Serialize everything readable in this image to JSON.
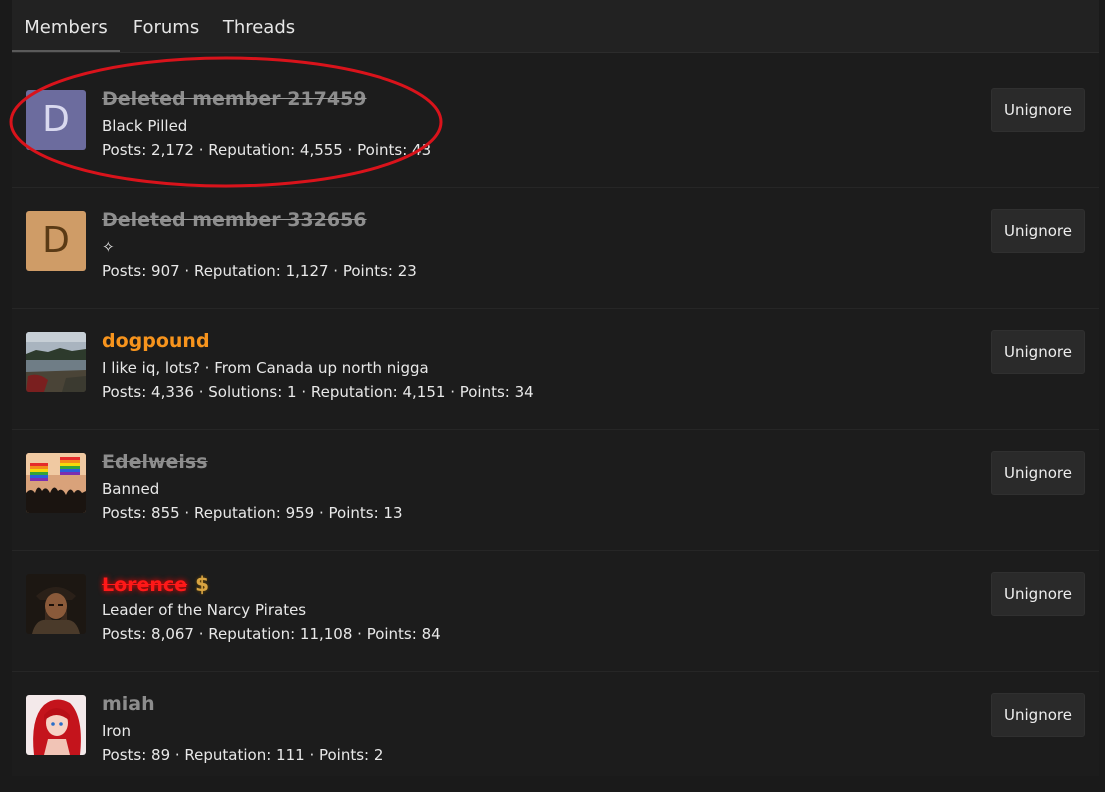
{
  "tabs": [
    {
      "label": "Members",
      "active": true
    },
    {
      "label": "Forums",
      "active": false
    },
    {
      "label": "Threads",
      "active": false
    }
  ],
  "members": [
    {
      "name": "Deleted member 217459",
      "title": "Black Pilled",
      "stats": "Posts: 2,172 · Reputation: 4,555 · Points: 43",
      "avatar_letter": "D",
      "avatar_color": "#6c6c9e",
      "avatar_letter_color": "#d9d9ef",
      "button": "Unignore"
    },
    {
      "name": "Deleted member 332656",
      "title": "✧",
      "stats": "Posts: 907 · Reputation: 1,127 · Points: 23",
      "avatar_letter": "D",
      "avatar_color": "#cf9c67",
      "avatar_letter_color": "#5a3a15",
      "button": "Unignore"
    },
    {
      "name": "dogpound",
      "title": "I like iq, lots? · From Canada up north nigga",
      "stats": "Posts: 4,336 · Solutions: 1 · Reputation: 4,151 · Points: 34",
      "button": "Unignore"
    },
    {
      "name": "Edelweiss",
      "title": "Banned",
      "stats": "Posts: 855 · Reputation: 959 · Points: 13",
      "button": "Unignore"
    },
    {
      "name": "Lorence",
      "badge": "$",
      "title": "Leader of the Narcy Pirates",
      "stats": "Posts: 8,067 · Reputation: 11,108 · Points: 84",
      "button": "Unignore"
    },
    {
      "name": "miah",
      "title": "Iron",
      "stats": "Posts: 89 · Reputation: 111 · Points: 2",
      "button": "Unignore"
    }
  ],
  "colors": {
    "background": "#1c1c1c",
    "deleted_name": "#8d8d8d",
    "orange_name": "#f7941d",
    "red_name": "#ff1a1a",
    "annotation": "#d9131b"
  }
}
